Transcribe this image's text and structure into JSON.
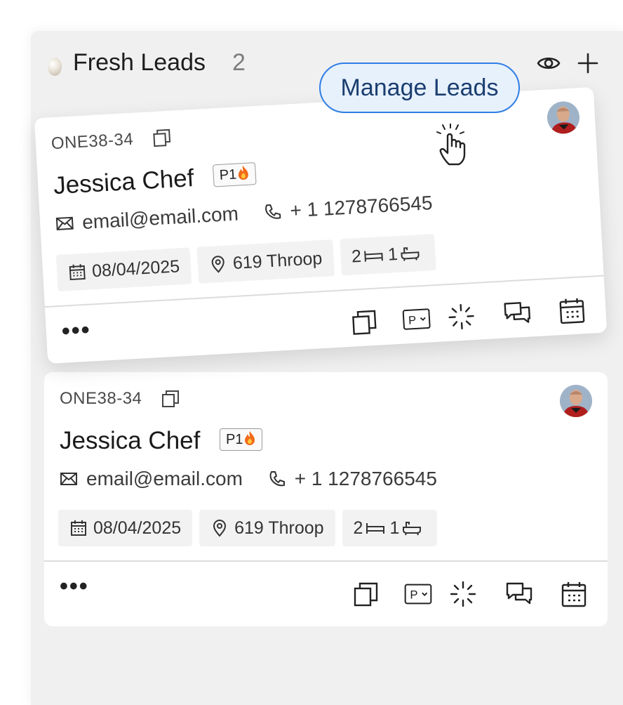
{
  "column": {
    "title": "Fresh Leads",
    "count": "2",
    "icons": [
      "eye-icon",
      "plus-icon"
    ]
  },
  "tooltip": {
    "label": "Manage Leads"
  },
  "cards": [
    {
      "lead_id": "ONE38-34",
      "name": "Jessica Chef",
      "priority": "P1",
      "email": "email@email.com",
      "phone": "+ 1 1278766545",
      "date": "08/04/2025",
      "address": "619 Throop",
      "beds": "2",
      "baths": "1",
      "more": "•••"
    },
    {
      "lead_id": "ONE38-34",
      "name": "Jessica Chef",
      "priority": "P1",
      "email": "email@email.com",
      "phone": "+ 1 1278766545",
      "date": "08/04/2025",
      "address": "619 Throop",
      "beds": "2",
      "baths": "1",
      "more": "•••"
    }
  ],
  "action_icons": [
    "copy-icon",
    "parking-icon",
    "loading-icon",
    "chat-icon",
    "calendar-icon"
  ],
  "colors": {
    "tooltip_border": "#2f7ee6",
    "tooltip_bg": "#e7f1fc",
    "column_bg": "#f0f0f0"
  }
}
